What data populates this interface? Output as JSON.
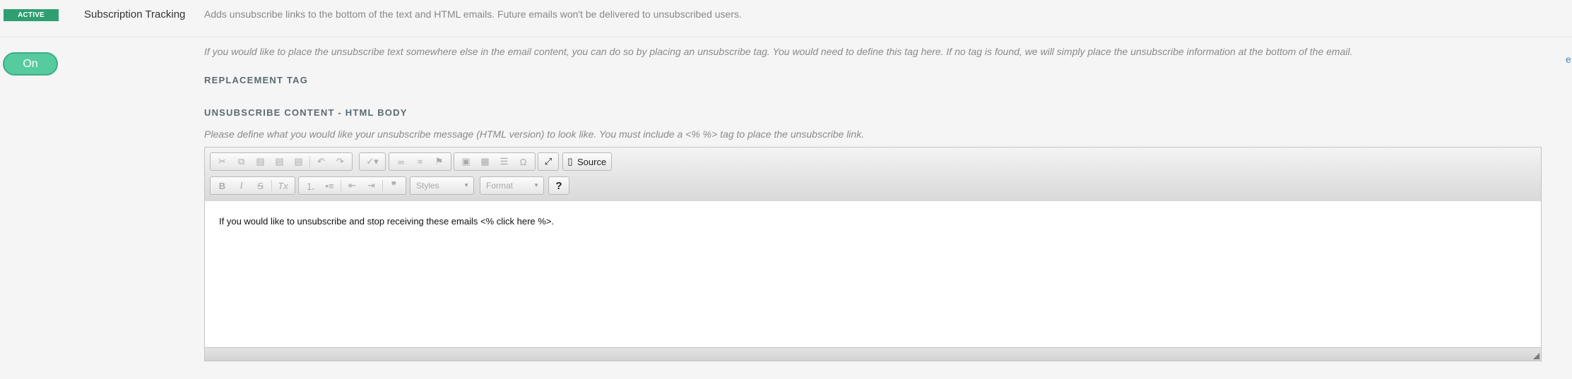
{
  "setting": {
    "status": "ACTIVE",
    "name": "Subscription Tracking",
    "description": "Adds unsubscribe links to the bottom of the text and HTML emails. Future emails won't be delivered to unsubscribed users."
  },
  "toggle": {
    "label": "On"
  },
  "edge_link": "e",
  "intro_text": "If you would like to place the unsubscribe text somewhere else in the email content, you can do so by placing an unsubscribe tag. You would need to define this tag here. If no tag is found, we will simply place the unsubscribe information at the bottom of the email.",
  "replacement_tag": {
    "label": "REPLACEMENT TAG"
  },
  "html_body": {
    "label": "UNSUBSCRIBE CONTENT - HTML BODY",
    "help": "Please define what you would like your unsubscribe message (HTML version) to look like. You must include a <% %> tag to place the unsubscribe link."
  },
  "editor": {
    "source_label": "Source",
    "styles_placeholder": "Styles",
    "format_placeholder": "Format",
    "help_label": "?",
    "content": "If you would like to unsubscribe and stop receiving these emails <% click here %>."
  },
  "colors": {
    "accent": "#2f9e72",
    "toggle": "#57cba0",
    "link": "#3a87c8"
  }
}
